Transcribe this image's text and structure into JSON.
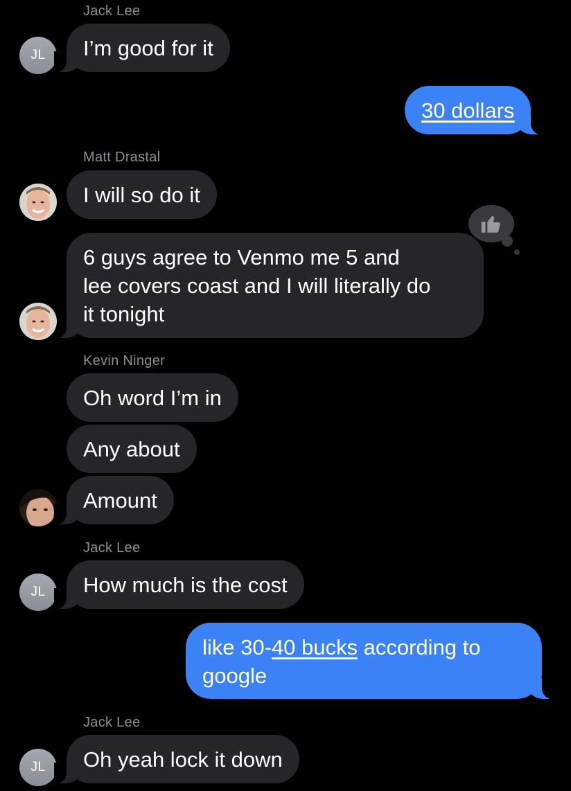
{
  "messages": [
    {
      "sender": "Jack Lee",
      "text": "I’m good for it",
      "direction": "incoming"
    },
    {
      "text": "30 dollars",
      "direction": "outgoing"
    },
    {
      "sender": "Matt Drastal",
      "text": "I will so do it",
      "direction": "incoming"
    },
    {
      "text_lines": [
        "6 guys agree to Venmo me 5 and",
        "lee covers coast and I will literally do",
        "it tonight"
      ],
      "direction": "incoming",
      "reaction": "thumbs-up"
    },
    {
      "sender": "Kevin Ninger",
      "text": "Oh word I’m in",
      "direction": "incoming"
    },
    {
      "text": "Any about",
      "direction": "incoming"
    },
    {
      "text": "Amount",
      "direction": "incoming"
    },
    {
      "sender": "Jack Lee",
      "text": "How much is the cost",
      "direction": "incoming"
    },
    {
      "text_pre": "like 30-",
      "text_link": "40 bucks",
      "text_post_1": " according to",
      "text_post_2": "google",
      "direction": "outgoing"
    },
    {
      "sender": "Jack Lee",
      "text": "Oh yeah lock it down",
      "direction": "incoming"
    }
  ],
  "avatars": {
    "jack_lee": "JL"
  },
  "colors": {
    "incoming": "#26252a",
    "outgoing": "#3b82f6",
    "sender_name": "#8e8e93"
  }
}
